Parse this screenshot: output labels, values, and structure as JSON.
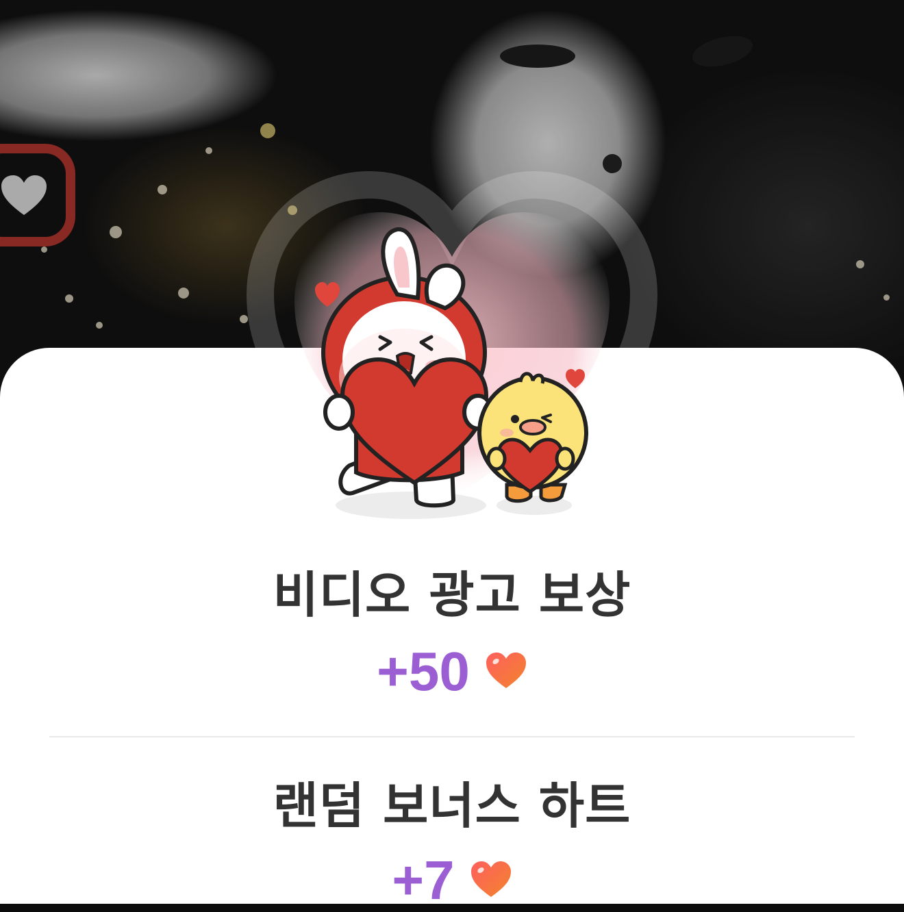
{
  "rewards": [
    {
      "title": "비디오 광고 보상",
      "amount": "+50"
    },
    {
      "title": "랜덤 보너스 하트",
      "amount": "+7"
    }
  ],
  "icons": {
    "reward_icon": "heart-icon",
    "heart_gradient": [
      "#ff5f5f",
      "#f2842c"
    ]
  },
  "colors": {
    "title": "#333333",
    "amount": "#9b5fd3",
    "sheet": "#ffffff"
  }
}
